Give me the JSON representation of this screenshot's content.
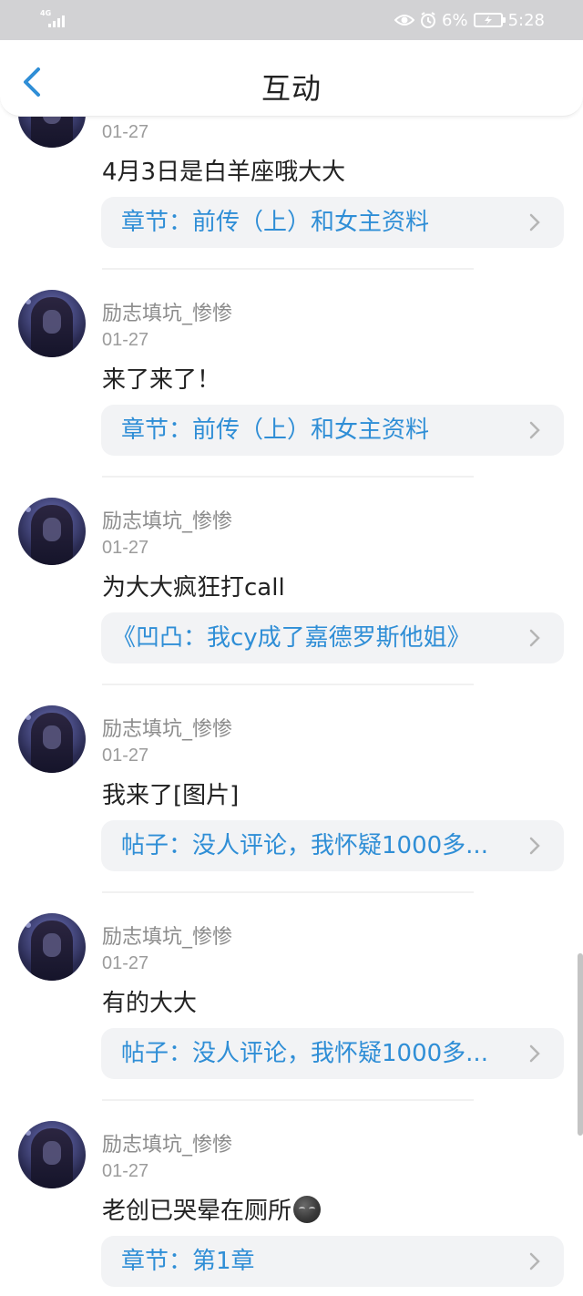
{
  "status_bar": {
    "network": "4G",
    "battery_percent": "6%",
    "time": "5:28",
    "icons": [
      "signal-icon",
      "eye-icon",
      "alarm-icon",
      "battery-charging-icon"
    ]
  },
  "header": {
    "title": "互动",
    "back_icon": "chevron-left-icon"
  },
  "colors": {
    "link": "#2f8ed6",
    "card_bg": "#f2f3f5",
    "status_bar": "#d2d2d4"
  },
  "items": [
    {
      "username": "",
      "date": "01-27",
      "message": "4月3日是白羊座哦大大",
      "ref": "章节：前传（上）和女主资料"
    },
    {
      "username": "励志填坑_惨惨",
      "date": "01-27",
      "message": "来了来了！",
      "ref": "章节：前传（上）和女主资料"
    },
    {
      "username": "励志填坑_惨惨",
      "date": "01-27",
      "message": "为大大疯狂打call",
      "ref": "《凹凸：我cy成了嘉德罗斯他姐》"
    },
    {
      "username": "励志填坑_惨惨",
      "date": "01-27",
      "message": "我来了[图片]",
      "ref": "帖子：没人评论，我怀疑1000多..."
    },
    {
      "username": "励志填坑_惨惨",
      "date": "01-27",
      "message": "有的大大",
      "ref": "帖子：没人评论，我怀疑1000多..."
    },
    {
      "username": "励志填坑_惨惨",
      "date": "01-27",
      "message": "老创已哭晕在厕所",
      "message_emoji": "dark-moon-face-emoji",
      "ref": "章节：第1章"
    }
  ]
}
